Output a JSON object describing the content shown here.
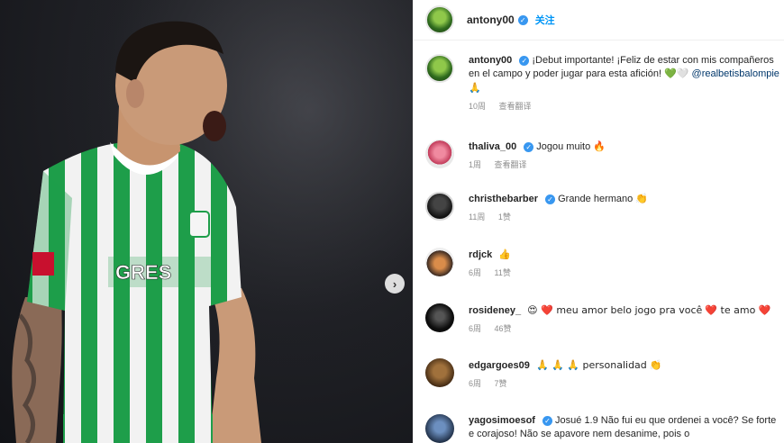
{
  "post": {
    "image_alt": "Player in green-and-white striped jersey shouting",
    "jersey_sponsor": "GRES",
    "next_icon": "chevron-right-icon"
  },
  "header": {
    "username": "antony00",
    "follow_label": "关注"
  },
  "comments": [
    {
      "username": "antony00",
      "text": "¡Debut importante! ¡Feliz de estar con mis compañeros en el campo y poder jugar para esta afición! 💚🤍",
      "mention": "@realbetisbalompie",
      "emoji": "🙏",
      "time": "10周",
      "translate": "查看翻译"
    },
    {
      "username": "thaliva_00",
      "text": "Jogou muito",
      "emoji": "🔥",
      "time": "1周",
      "translate": "查看翻译"
    },
    {
      "username": "christhebarber",
      "text": "Grande hermano",
      "emoji": "👏",
      "time": "11周",
      "likes": "1赞"
    },
    {
      "username": "rdjck",
      "text": "",
      "emoji": "👍",
      "time": "6周",
      "likes": "11赞"
    },
    {
      "username": "rosideney_",
      "text_parts": [
        "😍 ❤️ meu amor belo jogo pra você",
        "❤️ te amo ❤️"
      ],
      "time": "6周",
      "likes": "46赞"
    },
    {
      "username": "edgargoes09",
      "text": "🙏 🙏 🙏 personalidad",
      "emoji": "👏",
      "time": "6周",
      "likes": "7赞"
    },
    {
      "username": "yagosimoesof",
      "text": "Josué 1.9 Não fui eu que ordenei a você? Se forte e corajoso! Não se apavore nem desanime, pois o"
    }
  ],
  "colors": {
    "jersey_green": "#1e9e4a",
    "link_blue": "#0095f6",
    "verified_blue": "#3897f0"
  }
}
